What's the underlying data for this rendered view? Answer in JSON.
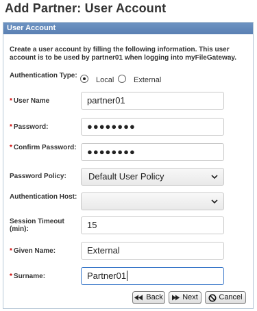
{
  "page_title": "Add Partner: User Account",
  "panel": {
    "header": "User Account",
    "intro": "Create a user account by filling the following information. This user account is to be used by partner01 when logging into myFileGateway."
  },
  "form": {
    "auth_type": {
      "label": "Authentication Type:",
      "options": [
        "Local",
        "External"
      ],
      "selected": "Local"
    },
    "user_name": {
      "label": "User Name",
      "value": "partner01"
    },
    "password": {
      "label": "Password:",
      "value": "●●●●●●●●"
    },
    "confirm_password": {
      "label": "Confirm Password:",
      "value": "●●●●●●●●"
    },
    "password_policy": {
      "label": "Password Policy:",
      "value": "Default User Policy"
    },
    "auth_host": {
      "label": "Authentication Host:",
      "value": ""
    },
    "session_timeout": {
      "label": "Session Timeout (min):",
      "value": "15"
    },
    "given_name": {
      "label": "Given Name:",
      "value": "External"
    },
    "surname": {
      "label": "Surname:",
      "value": "Partner01"
    },
    "required_marker": "*"
  },
  "buttons": {
    "back": "Back",
    "next": "Next",
    "cancel": "Cancel"
  },
  "icons": {
    "back": "back-double-arrow-icon",
    "next": "next-arrow-icon",
    "cancel": "cancel-circle-slash-icon",
    "dropdown": "chevron-down-icon"
  },
  "colors": {
    "header_bg": "#5a80b3",
    "required": "#cc0000",
    "focus_border": "#3a78c9"
  }
}
